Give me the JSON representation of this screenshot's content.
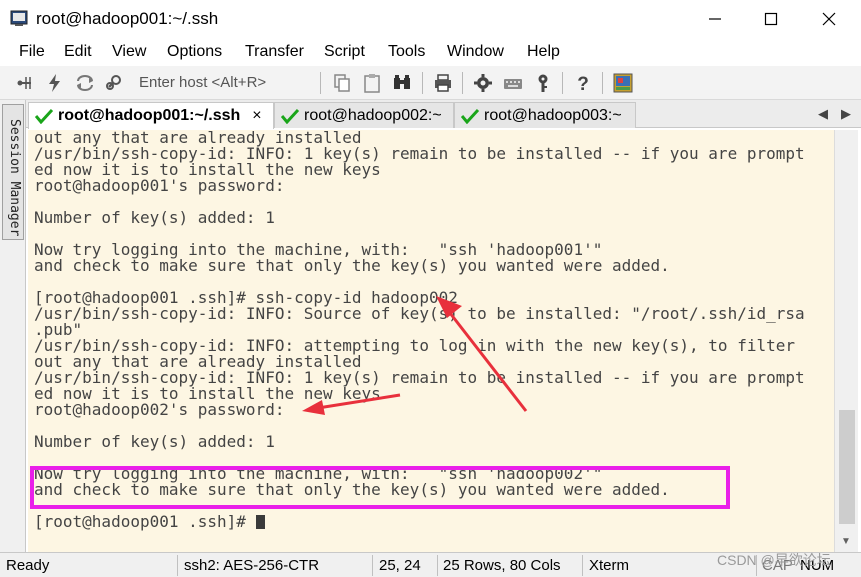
{
  "window": {
    "title": "root@hadoop001:~/.ssh"
  },
  "menu": {
    "items": [
      "File",
      "Edit",
      "View",
      "Options",
      "Transfer",
      "Script",
      "Tools",
      "Window",
      "Help"
    ]
  },
  "toolbar": {
    "enter_host_placeholder": "Enter host <Alt+R>"
  },
  "session_manager": {
    "label": "Session Manager"
  },
  "tabs": [
    {
      "label": "root@hadoop001:~/.ssh",
      "active": true,
      "close": "×"
    },
    {
      "label": "root@hadoop002:~",
      "active": false
    },
    {
      "label": "root@hadoop003:~",
      "active": false
    }
  ],
  "tab_nav": {
    "left": "◀",
    "right": "▶"
  },
  "terminal": {
    "lines": [
      "out any that are already installed",
      "/usr/bin/ssh-copy-id: INFO: 1 key(s) remain to be installed -- if you are prompt",
      "ed now it is to install the new keys",
      "root@hadoop001's password: ",
      "",
      "Number of key(s) added: 1",
      "",
      "Now try logging into the machine, with:   \"ssh 'hadoop001'\"",
      "and check to make sure that only the key(s) you wanted were added.",
      "",
      "[root@hadoop001 .ssh]# ssh-copy-id hadoop002",
      "/usr/bin/ssh-copy-id: INFO: Source of key(s) to be installed: \"/root/.ssh/id_rsa",
      ".pub\"",
      "/usr/bin/ssh-copy-id: INFO: attempting to log in with the new key(s), to filter",
      "out any that are already installed",
      "/usr/bin/ssh-copy-id: INFO: 1 key(s) remain to be installed -- if you are prompt",
      "ed now it is to install the new keys",
      "root@hadoop002's password: ",
      "",
      "Number of key(s) added: 1",
      "",
      "Now try logging into the machine, with:   \"ssh 'hadoop002'\"",
      "and check to make sure that only the key(s) you wanted were added.",
      "",
      "[root@hadoop001 .ssh]# "
    ]
  },
  "status": {
    "ready": "Ready",
    "encryption": "ssh2: AES-256-CTR",
    "cursor_pos": "25,  24",
    "dimensions": "25 Rows, 80 Cols",
    "terminal_type": "Xterm",
    "caps": "CAP",
    "num": "NUM"
  },
  "watermark": "CSDN @早欲论坛",
  "colors": {
    "terminal_bg": "#fdf6e3",
    "terminal_fg": "#444444",
    "highlight": "#e91fe9",
    "arrow": "#e8303c",
    "tab_check": "#1aa51a"
  }
}
